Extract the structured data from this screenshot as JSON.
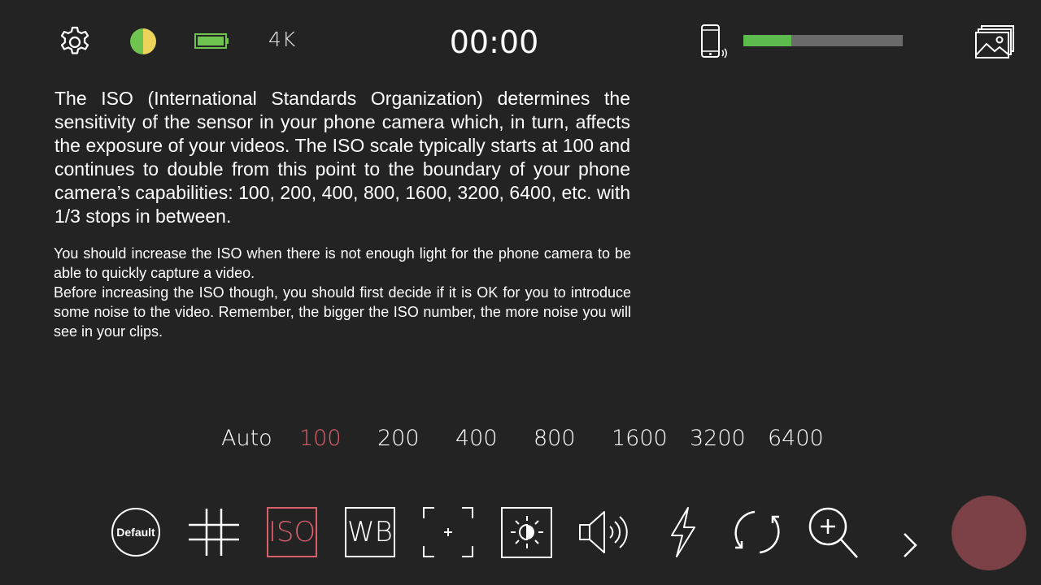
{
  "top_bar": {
    "quality_label": "4K",
    "timer": "00:00",
    "storage_used_fraction": 0.3
  },
  "info": {
    "paragraph_1": "The ISO (International Standards Organization) determines the sensitivity of the sensor in your phone camera which, in turn, affects the exposure of your videos. The ISO scale typically starts at 100 and continues to double from this point to the boundary of your phone camera’s capabilities: 100, 200, 400, 800, 1600, 3200, 6400, etc. with 1/3 stops in between.",
    "paragraph_2_line_1": "You should increase the ISO when there is not enough light for the phone camera to be able to quickly capture a video.",
    "paragraph_2_line_2": "Before increasing the ISO though, you should first decide if it is OK for you to introduce some noise to the video. Remember, the bigger the ISO number, the more noise you will see in your clips."
  },
  "iso_options": [
    "Auto",
    "100",
    "200",
    "400",
    "800",
    "1600",
    "3200",
    "6400"
  ],
  "iso_selected": "100",
  "toolbar": {
    "default_label": "Default",
    "iso_label": "ISO",
    "wb_label": "WB"
  },
  "colors": {
    "background": "#232323",
    "accent": "#d8606b",
    "storage_fill": "#5dbb4e",
    "record_button": "#7b4147"
  },
  "icons": [
    "gear-icon",
    "half-circle-icon",
    "battery-icon",
    "phone-icon",
    "gallery-icon",
    "grid-icon",
    "focus-icon",
    "exposure-icon",
    "speaker-icon",
    "flash-icon",
    "rotate-icon",
    "zoom-in-icon",
    "chevron-right-icon"
  ]
}
